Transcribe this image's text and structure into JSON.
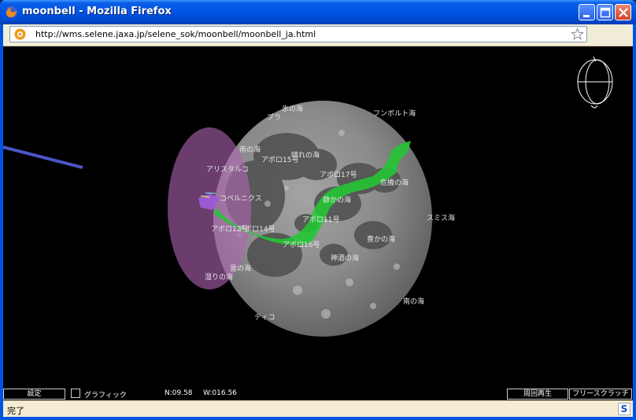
{
  "window": {
    "title": "moonbell - Mozilla Firefox",
    "minimize_icon": "minimize-icon",
    "maximize_icon": "maximize-icon",
    "close_icon": "close-icon"
  },
  "navbar": {
    "url": "http://wms.selene.jaxa.jp/selene_sok/moonbell/moonbell_ja.html",
    "bookmark_icon": "star-icon"
  },
  "moon_labels": [
    {
      "text": "氷の海"
    },
    {
      "text": "フンボルト海"
    },
    {
      "text": "プラ"
    },
    {
      "text": "雨の海"
    },
    {
      "text": "晴れの海"
    },
    {
      "text": "アポロ15号"
    },
    {
      "text": "アリスタルコ"
    },
    {
      "text": "アポロ17号"
    },
    {
      "text": "危機の海"
    },
    {
      "text": "コペルニクス"
    },
    {
      "text": "静かの海"
    },
    {
      "text": "スミス海"
    },
    {
      "text": "アポロ11号"
    },
    {
      "text": "アポロ12号"
    },
    {
      "text": "アポロ14号"
    },
    {
      "text": "豊かの海"
    },
    {
      "text": "アポロ16号"
    },
    {
      "text": "神酒の海"
    },
    {
      "text": "雲の海"
    },
    {
      "text": "湿りの海"
    },
    {
      "text": "南の海"
    },
    {
      "text": "ティコ"
    }
  ],
  "bottom": {
    "settings_label": "設定",
    "graphic_label": "グラフィック",
    "north": "N:09.58",
    "west": "W:016.56",
    "replay_label": "周回再生",
    "free_label": "フリースクラッチ"
  },
  "status": {
    "text": "完了",
    "addon_label": "S"
  },
  "colors": {
    "titlebar": "#0054e3",
    "viewer_bg": "#000000",
    "orbit_track": "#22c833",
    "sensor_cone": "#b066b5",
    "orbit_line": "#4d55c8"
  }
}
